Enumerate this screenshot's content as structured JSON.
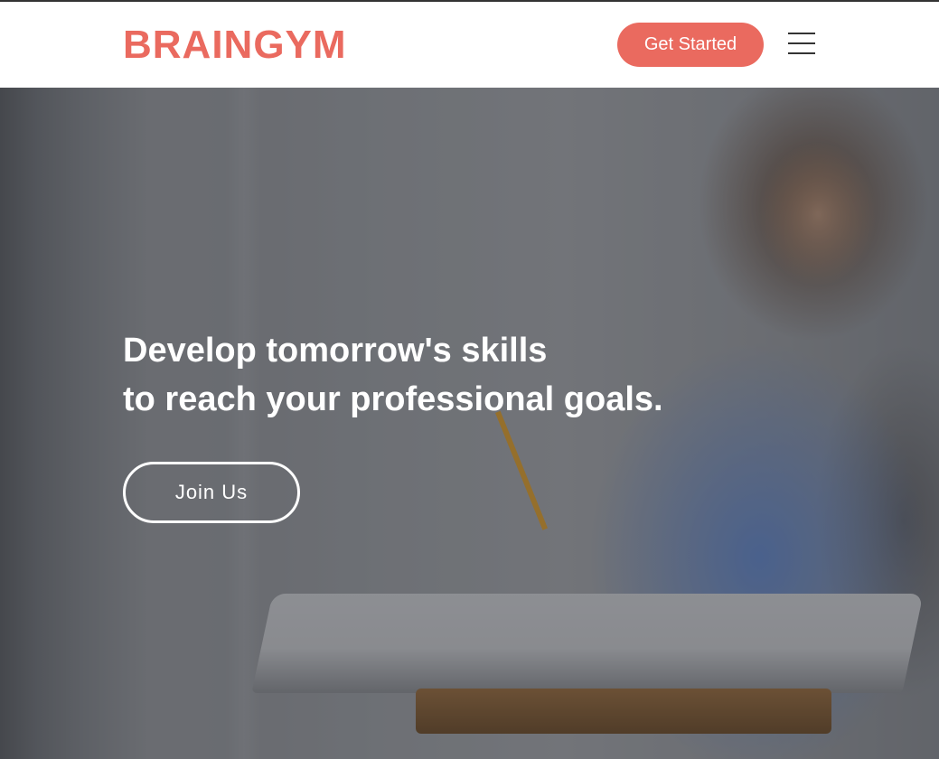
{
  "header": {
    "brand": "BRAINGYM",
    "cta_label": "Get Started",
    "menu_icon": "hamburger-menu-icon"
  },
  "hero": {
    "headline_line1": "Develop tomorrow's skills",
    "headline_line2": "to reach your professional goals.",
    "join_label": "Join Us"
  },
  "colors": {
    "accent": "#ea6a5f",
    "hero_text": "#ffffff"
  }
}
